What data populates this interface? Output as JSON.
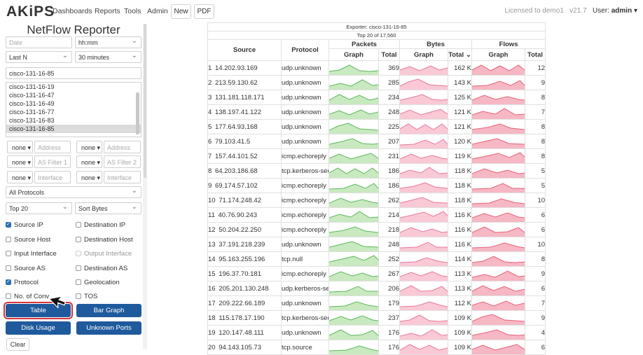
{
  "nav": {
    "logo": "AKiPS",
    "items": [
      "Dashboards",
      "Reports",
      "Tools",
      "Admin"
    ],
    "buttons": [
      "New",
      "PDF"
    ],
    "license": "Licensed to demo1",
    "version": "v21.7",
    "user_label": "User:",
    "user_name": "admin"
  },
  "panel": {
    "title": "NetFlow Reporter",
    "date_placeholder": "Date",
    "time_placeholder": "hh:mm",
    "range_mode": "Last N",
    "range_value": "30 minutes",
    "device_filter": "cisco-131-16-85",
    "devices": [
      "cisco-131-16-19",
      "cisco-131-16-47",
      "cisco-131-16-49",
      "cisco-131-16-77",
      "cisco-131-16-83",
      "cisco-131-16-85"
    ],
    "selected_device": "cisco-131-16-85",
    "filters": [
      {
        "mode": "none",
        "placeholder": "Address Filt"
      },
      {
        "mode": "none",
        "placeholder": "Address Filt"
      },
      {
        "mode": "none",
        "placeholder": "AS Filter 1"
      },
      {
        "mode": "none",
        "placeholder": "AS Filter 2"
      },
      {
        "mode": "none",
        "placeholder": "Interface Fil"
      },
      {
        "mode": "none",
        "placeholder": "Interface Fil"
      }
    ],
    "protocols": "All Protocols",
    "top_n": "Top 20",
    "sort": "Sort Bytes",
    "checks": [
      {
        "label": "Source IP",
        "checked": true,
        "dim": false
      },
      {
        "label": "Destination IP",
        "checked": false,
        "dim": false
      },
      {
        "label": "Source Host",
        "checked": false,
        "dim": false
      },
      {
        "label": "Destination Host",
        "checked": false,
        "dim": false
      },
      {
        "label": "Input Interface",
        "checked": false,
        "dim": false
      },
      {
        "label": "Output Interface",
        "checked": false,
        "dim": true
      },
      {
        "label": "Source AS",
        "checked": false,
        "dim": false
      },
      {
        "label": "Destination AS",
        "checked": false,
        "dim": false
      },
      {
        "label": "Protocol",
        "checked": true,
        "dim": false
      },
      {
        "label": "Geolocation",
        "checked": false,
        "dim": false
      },
      {
        "label": "No. of Conv",
        "checked": false,
        "dim": false
      },
      {
        "label": "TOS",
        "checked": false,
        "dim": false
      }
    ],
    "buttons": {
      "table": "Table",
      "bar_graph": "Bar Graph",
      "disk_usage": "Disk Usage",
      "unknown_ports": "Unknown Ports",
      "clear": "Clear"
    }
  },
  "report": {
    "exporter": "Exporter: cisco-131-16-85",
    "subtitle": "Top 20 of 17,560",
    "headers": {
      "source": "Source",
      "protocol": "Protocol",
      "packets": "Packets",
      "bytes": "Bytes",
      "flows": "Flows",
      "graph": "Graph",
      "total": "Total",
      "total_sorted": "Total ⌄"
    },
    "colors": {
      "packets": "#5cb85c",
      "bytes": "#e8789a",
      "flows": "#e8607a"
    },
    "rows": [
      {
        "n": "1",
        "source": "14.202.93.169",
        "protocol": "udp.unknown",
        "packets": "369",
        "bytes": "162 K",
        "flows": "12"
      },
      {
        "n": "2",
        "source": "213.59.130.62",
        "protocol": "udp.unknown",
        "packets": "285",
        "bytes": "143 K",
        "flows": "9"
      },
      {
        "n": "3",
        "source": "131.181.118.171",
        "protocol": "udp.unknown",
        "packets": "234",
        "bytes": "125 K",
        "flows": "8"
      },
      {
        "n": "4",
        "source": "138.197.41.122",
        "protocol": "udp.unknown",
        "packets": "248",
        "bytes": "121 K",
        "flows": "7"
      },
      {
        "n": "5",
        "source": "177.64.93.168",
        "protocol": "udp.unknown",
        "packets": "225",
        "bytes": "121 K",
        "flows": "8"
      },
      {
        "n": "6",
        "source": "79.103.41.5",
        "protocol": "udp.unknown",
        "packets": "207",
        "bytes": "120 K",
        "flows": "8"
      },
      {
        "n": "7",
        "source": "157.44.101.52",
        "protocol": "icmp.echoreply",
        "packets": "231",
        "bytes": "119 K",
        "flows": "8"
      },
      {
        "n": "8",
        "source": "64.203.186.68",
        "protocol": "tcp.kerberos-sec",
        "packets": "186",
        "bytes": "118 K",
        "flows": "5"
      },
      {
        "n": "9",
        "source": "69.174.57.102",
        "protocol": "icmp.echoreply",
        "packets": "186",
        "bytes": "118 K",
        "flows": "5"
      },
      {
        "n": "10",
        "source": "71.174.248.42",
        "protocol": "icmp.echoreply",
        "packets": "262",
        "bytes": "118 K",
        "flows": "10"
      },
      {
        "n": "11",
        "source": "40.76.90.243",
        "protocol": "icmp.echoreply",
        "packets": "214",
        "bytes": "116 K",
        "flows": "6"
      },
      {
        "n": "12",
        "source": "50.204.22.250",
        "protocol": "icmp.echoreply",
        "packets": "218",
        "bytes": "116 K",
        "flows": "6"
      },
      {
        "n": "13",
        "source": "37.191.218.239",
        "protocol": "udp.unknown",
        "packets": "248",
        "bytes": "116 K",
        "flows": "10"
      },
      {
        "n": "14",
        "source": "95.163.255.196",
        "protocol": "tcp.null",
        "packets": "252",
        "bytes": "114 K",
        "flows": "8"
      },
      {
        "n": "15",
        "source": "196.37.70.181",
        "protocol": "icmp.echoreply",
        "packets": "267",
        "bytes": "113 K",
        "flows": "9"
      },
      {
        "n": "16",
        "source": "205.201.130.248",
        "protocol": "udp.kerberos-sec",
        "packets": "206",
        "bytes": "113 K",
        "flows": "6"
      },
      {
        "n": "17",
        "source": "209.222.66.189",
        "protocol": "udp.unknown",
        "packets": "179",
        "bytes": "112 K",
        "flows": "7"
      },
      {
        "n": "18",
        "source": "115.178.17.190",
        "protocol": "tcp.kerberos-sec",
        "packets": "237",
        "bytes": "109 K",
        "flows": "9"
      },
      {
        "n": "19",
        "source": "120.147.48.111",
        "protocol": "udp.unknown",
        "packets": "176",
        "bytes": "109 K",
        "flows": "4"
      },
      {
        "n": "20",
        "source": "94.143.105.73",
        "protocol": "tcp.source",
        "packets": "176",
        "bytes": "109 K",
        "flows": "6"
      }
    ]
  }
}
